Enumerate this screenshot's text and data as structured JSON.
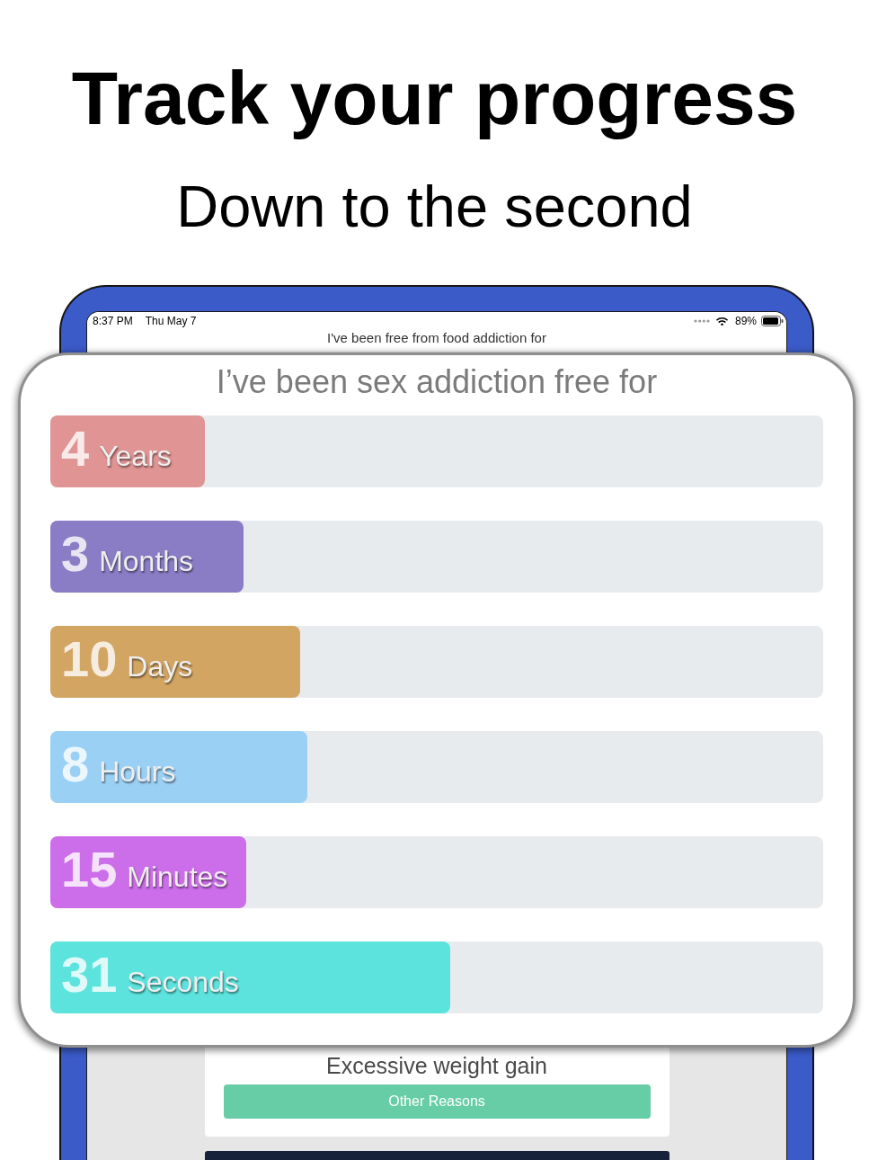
{
  "headline": {
    "title": "Track your progress",
    "subtitle": "Down to the second"
  },
  "tablet": {
    "status_bar": {
      "time": "8:37 PM",
      "date": "Thu May 7",
      "battery": "89%"
    },
    "screen_heading": "I've been free from food addiction for",
    "reason": "Excessive weight gain",
    "button": "Other Reasons"
  },
  "card": {
    "title": "I’ve been sex addiction free for",
    "bars": [
      {
        "value": "4",
        "unit": "Years",
        "level": 0.2,
        "color": "#e09494"
      },
      {
        "value": "3",
        "unit": "Months",
        "level": 0.25,
        "color": "#8a7dc5"
      },
      {
        "value": "10",
        "unit": "Days",
        "level": 0.323,
        "color": "#d2a563"
      },
      {
        "value": "8",
        "unit": "Hours",
        "level": 0.333,
        "color": "#9bd0f5"
      },
      {
        "value": "15",
        "unit": "Minutes",
        "level": 0.253,
        "color": "#cc6ee9"
      },
      {
        "value": "31",
        "unit": "Seconds",
        "level": 0.518,
        "color": "#5de3dd"
      }
    ]
  }
}
